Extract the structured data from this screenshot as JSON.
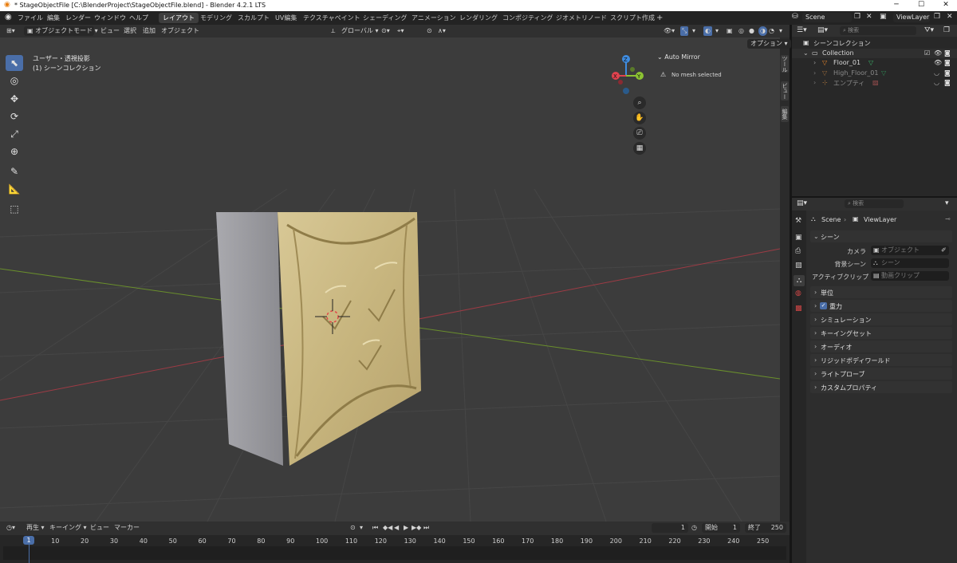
{
  "window": {
    "title": "* StageObjectFile [C:\\BlenderProject\\StageObjectFile.blend] - Blender 4.2.1 LTS",
    "minimize": "─",
    "maximize": "☐",
    "close": "✕"
  },
  "menu": [
    "ファイル",
    "編集",
    "レンダー",
    "ウィンドウ",
    "ヘルプ"
  ],
  "workspaces": [
    "レイアウト",
    "モデリング",
    "スカルプト",
    "UV編集",
    "テクスチャペイント",
    "シェーディング",
    "アニメーション",
    "レンダリング",
    "コンポジティング",
    "ジオメトリノード",
    "スクリプト作成"
  ],
  "workspace_add": "+",
  "scene_field": "Scene",
  "viewlayer_field": "ViewLayer",
  "viewport_header": {
    "mode": "オブジェクトモード",
    "view": "ビュー",
    "select": "選択",
    "add": "追加",
    "object": "オブジェクト",
    "transform_orientation": "グローバル",
    "options": "オプション"
  },
  "viewport": {
    "view_name": "ユーザー・透視投影",
    "collection": "(1) シーンコレクション",
    "gizmo_axes": {
      "x": "X",
      "y": "Y",
      "z": "Z"
    }
  },
  "auto_mirror": {
    "title": "Auto Mirror",
    "message": "No mesh selected"
  },
  "side_tabs": [
    "ツール",
    "ビュー",
    "編集"
  ],
  "outliner": {
    "search_placeholder": "検索",
    "root": "シーンコレクション",
    "collection": "Collection",
    "items": [
      {
        "name": "Floor_01"
      },
      {
        "name": "High_Floor_01"
      },
      {
        "name": "エンプティ"
      }
    ]
  },
  "properties": {
    "search_placeholder": "検索",
    "breadcrumb_scene": "Scene",
    "breadcrumb_layer": "ViewLayer",
    "scene_section": "シーン",
    "camera_label": "カメラ",
    "camera_placeholder": "オブジェクト",
    "bg_scene_label": "背景シーン",
    "bg_scene_placeholder": "シーン",
    "active_clip_label": "アクティブクリップ",
    "active_clip_placeholder": "動画クリップ",
    "sections": [
      "単位",
      "重力",
      "シミュレーション",
      "キーイングセット",
      "オーディオ",
      "リジッドボディワールド",
      "ライトプローブ",
      "カスタムプロパティ"
    ],
    "gravity_checked": true
  },
  "timeline": {
    "play": "再生",
    "keying": "キーイング",
    "view": "ビュー",
    "marker": "マーカー",
    "current_frame": "1",
    "start_label": "開始",
    "start": "1",
    "end_label": "終了",
    "end": "250",
    "ticks": [
      "1",
      "10",
      "20",
      "30",
      "40",
      "50",
      "60",
      "70",
      "80",
      "90",
      "100",
      "110",
      "120",
      "130",
      "140",
      "150",
      "160",
      "170",
      "180",
      "190",
      "200",
      "210",
      "220",
      "230",
      "240",
      "250"
    ]
  },
  "colors": {
    "accent": "#4a6ea8",
    "x_axis": "#e0434f",
    "y_axis": "#8cc332",
    "z_axis": "#3f8ce0",
    "mesh": "#c9b887"
  }
}
